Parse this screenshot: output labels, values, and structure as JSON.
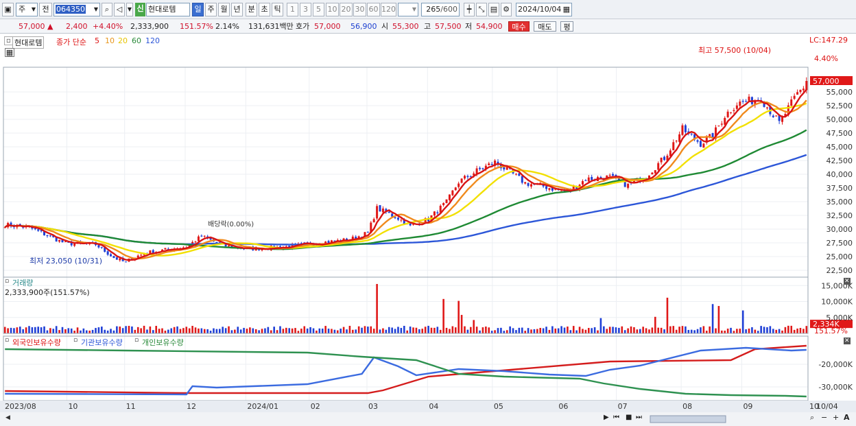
{
  "toolbar": {
    "type_label": "주",
    "prev_label": "전",
    "code": "064350",
    "new_badge": "신",
    "stock_name": "현대로템",
    "period_tabs": [
      "일",
      "주",
      "월",
      "년",
      "분",
      "초",
      "틱"
    ],
    "active_period": "일",
    "intervals": [
      "1",
      "3",
      "5",
      "10",
      "20",
      "30",
      "60",
      "120"
    ],
    "count": "265",
    "count_max": "/600",
    "date": "2024/10/04"
  },
  "quote": {
    "price": "57,000",
    "change": "2,400",
    "change_pct": "+4.40%",
    "volume": "2,333,900",
    "volume_ratio": "151.57%",
    "turnover": "2.14%",
    "amount": "131,631백만",
    "ask_label": "호가",
    "ask": "57,000",
    "bid": "56,900",
    "open_label": "시",
    "open": "55,300",
    "high_label": "고",
    "high": "57,500",
    "low_label": "저",
    "low": "54,900",
    "buy_label": "매수",
    "sell_label": "매도",
    "eval_label": "평"
  },
  "chart_data": [
    {
      "type": "candlestick",
      "legend": {
        "name": "현대로템",
        "ma_label": "종가 단순",
        "periods": [
          "5",
          "10",
          "20",
          "60",
          "120"
        ]
      },
      "y_ticks": [
        "55,000",
        "52,500",
        "50,000",
        "47,500",
        "45,000",
        "42,500",
        "40,000",
        "37,500",
        "35,000",
        "32,500",
        "30,000",
        "27,500",
        "25,000",
        "22,500"
      ],
      "ylim": [
        21500,
        58500
      ],
      "anchor_closes": [
        [
          0,
          30800
        ],
        [
          8,
          30300
        ],
        [
          20,
          27400
        ],
        [
          30,
          27200
        ],
        [
          36,
          24800
        ],
        [
          40,
          23900
        ],
        [
          42,
          24800
        ],
        [
          48,
          25800
        ],
        [
          60,
          26800
        ],
        [
          65,
          28700
        ],
        [
          72,
          27000
        ],
        [
          80,
          26400
        ],
        [
          92,
          26700
        ],
        [
          102,
          27400
        ],
        [
          114,
          28100
        ],
        [
          120,
          29300
        ],
        [
          123,
          33800
        ],
        [
          130,
          32000
        ],
        [
          134,
          30500
        ],
        [
          140,
          31800
        ],
        [
          146,
          34900
        ],
        [
          150,
          38600
        ],
        [
          156,
          40600
        ],
        [
          162,
          42200
        ],
        [
          168,
          40000
        ],
        [
          172,
          38400
        ],
        [
          178,
          37800
        ],
        [
          186,
          36700
        ],
        [
          192,
          39100
        ],
        [
          200,
          39500
        ],
        [
          206,
          38000
        ],
        [
          212,
          39700
        ],
        [
          218,
          43000
        ],
        [
          224,
          48200
        ],
        [
          230,
          45600
        ],
        [
          234,
          47000
        ],
        [
          238,
          50700
        ],
        [
          242,
          52900
        ],
        [
          250,
          53800
        ],
        [
          256,
          49300
        ],
        [
          262,
          54700
        ],
        [
          266,
          57000
        ]
      ],
      "latest_close": 57000,
      "annotations": {
        "high": "최고 57,500 (10/04)",
        "low": "최저 23,050 (10/31)",
        "dividend": "배당락(0.00%)",
        "change_pct": "4.40%",
        "lc": "LC:147.29"
      },
      "x_labels": [
        "2023/08",
        "10",
        "11",
        "12",
        "2024/01",
        "02",
        "03",
        "04",
        "05",
        "06",
        "07",
        "08",
        "09",
        "10",
        "10/04"
      ]
    },
    {
      "type": "bar",
      "title": "거래량",
      "subtitle": "2,333,900주(151.57%)",
      "y_ticks": [
        "15,000K",
        "10,000K",
        "5,000K"
      ],
      "latest": "2,334K",
      "latest_pct": "151.57%",
      "ylim": [
        0,
        17000
      ]
    },
    {
      "type": "line",
      "series": [
        {
          "name": "외국인보유수량",
          "color": "#d41c1c"
        },
        {
          "name": "기관보유수량",
          "color": "#3b6be0"
        },
        {
          "name": "개인보유수량",
          "color": "#2e9150"
        }
      ],
      "y_ticks": [
        "-20,000K",
        "-30,000K"
      ]
    }
  ]
}
